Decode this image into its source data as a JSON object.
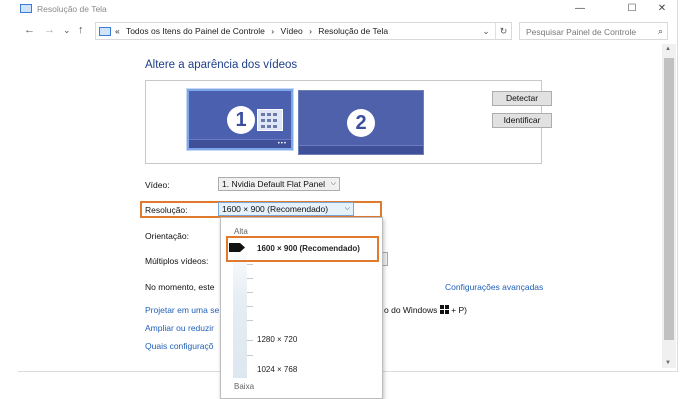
{
  "window": {
    "title": "Resolução de Tela",
    "minimize_glyph": "—",
    "maximize_glyph": "☐",
    "close_glyph": "✕"
  },
  "nav": {
    "back_glyph": "←",
    "forward_glyph": "→",
    "recent_glyph": "⌄",
    "up_glyph": "↑",
    "breadcrumb_prefix": "«",
    "breadcrumbs": [
      "Todos os Itens do Painel de Controle",
      "Vídeo",
      "Resolução de Tela"
    ],
    "separator": "›",
    "dropdown_glyph": "⌄",
    "refresh_glyph": "↻",
    "search_placeholder": "Pesquisar Painel de Controle",
    "search_glyph": "⌕"
  },
  "main": {
    "heading": "Altere a aparência dos vídeos",
    "monitors": [
      {
        "number": "1"
      },
      {
        "number": "2"
      }
    ],
    "detect_label": "Detectar",
    "identify_label": "Identificar",
    "display_label": "Vídeo:",
    "display_value": "1. Nvidia Default Flat Panel",
    "resolution_label": "Resolução:",
    "resolution_value": "1600 × 900 (Recomendado)",
    "orientation_label": "Orientação:",
    "multiple_label": "Múltiplos vídeos:",
    "info_text_fragment": "No momento, este",
    "advanced_link": "Configurações avançadas",
    "project_link_fragment": "Projetar em uma se",
    "project_suffix_fragment": "o do Windows",
    "project_shortcut": "+ P)",
    "enlarge_link_fragment": "Ampliar ou reduzir",
    "which_settings_link_fragment": "Quais configuraçõ"
  },
  "resolution_dropdown": {
    "high_label": "Alta",
    "low_label": "Baixa",
    "options": [
      {
        "label": "1600 × 900 (Recomendado)",
        "selected": true
      },
      {
        "label": "1280 × 720",
        "selected": false
      },
      {
        "label": "1024 × 768",
        "selected": false
      }
    ]
  },
  "colors": {
    "highlight": "#e07a2e",
    "heading": "#1e3f8a",
    "link": "#1f5fb8",
    "monitor": "#4c60b0"
  }
}
